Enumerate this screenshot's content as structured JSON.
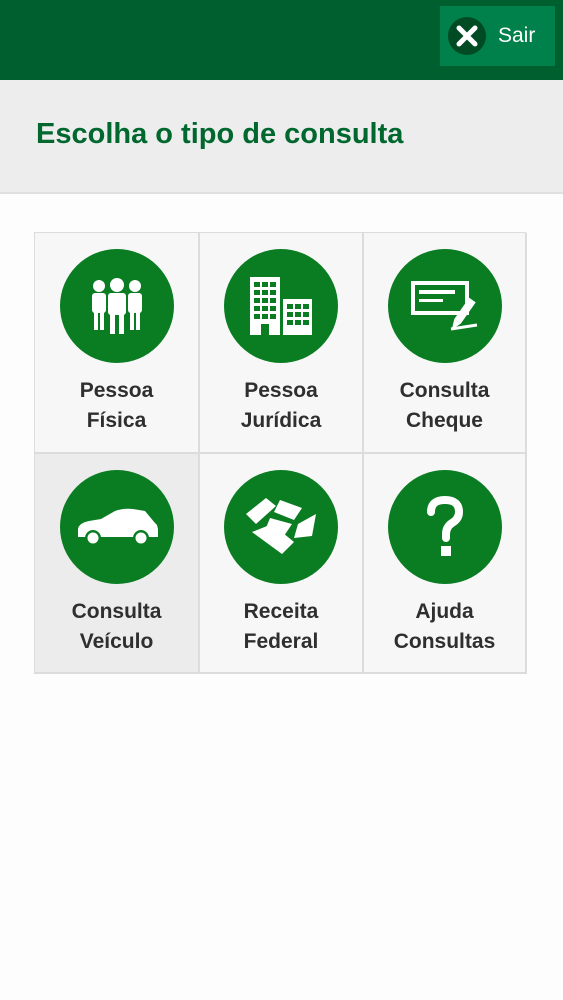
{
  "topbar": {
    "exit": {
      "label": "Sair",
      "icon": "close-icon"
    }
  },
  "header": {
    "title": "Escolha o tipo de consulta"
  },
  "tiles": [
    {
      "line1": "Pessoa",
      "line2": "Física",
      "icon": "people-icon"
    },
    {
      "line1": "Pessoa",
      "line2": "Jurídica",
      "icon": "buildings-icon"
    },
    {
      "line1": "Consulta",
      "line2": "Cheque",
      "icon": "check-pen-icon"
    },
    {
      "line1": "Consulta",
      "line2": "Veículo",
      "icon": "car-icon"
    },
    {
      "line1": "Receita",
      "line2": "Federal",
      "icon": "receita-federal-logo-icon"
    },
    {
      "line1": "Ajuda",
      "line2": "Consultas",
      "icon": "question-mark-icon"
    }
  ],
  "colors": {
    "topbar": "#005f2f",
    "exit_button": "#00804a",
    "accent_green": "#0a7d22",
    "title_green": "#00682f"
  }
}
